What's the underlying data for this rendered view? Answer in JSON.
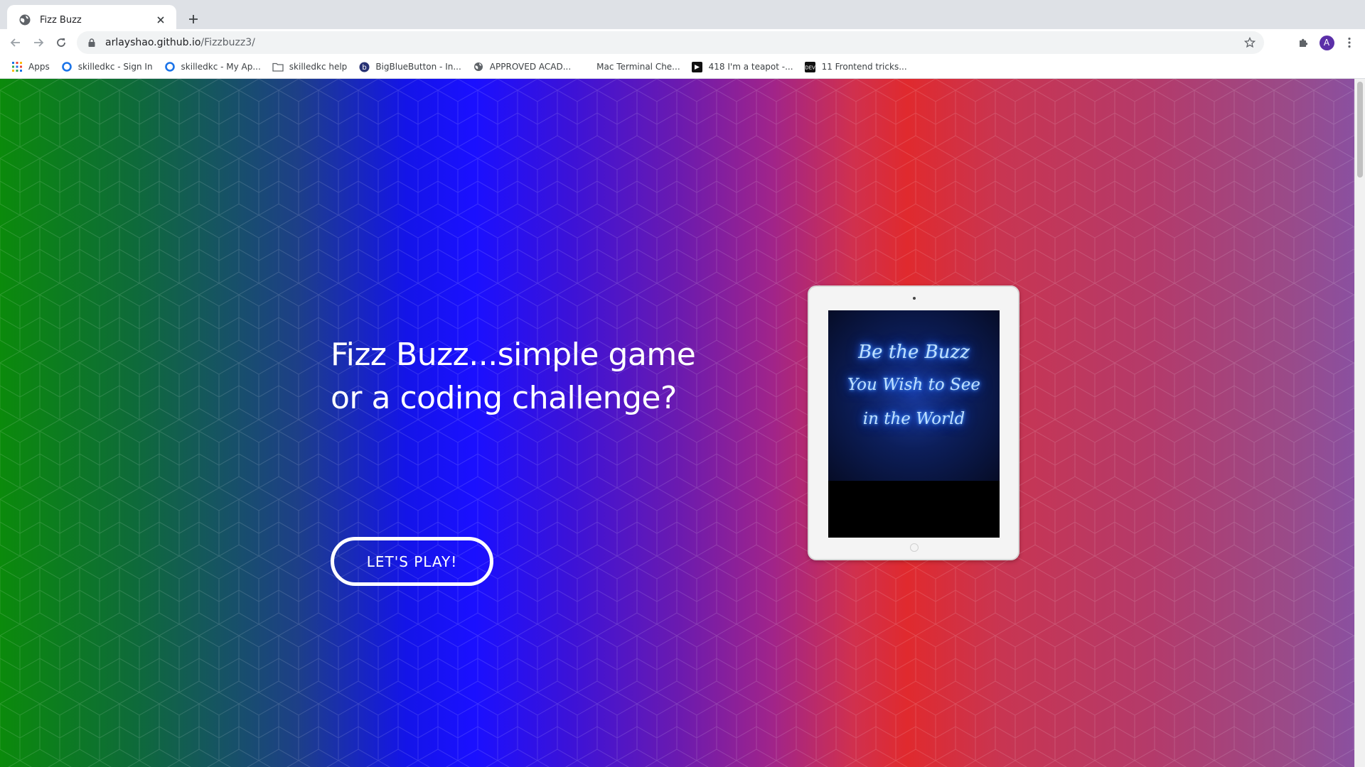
{
  "browser": {
    "tab": {
      "title": "Fizz Buzz",
      "favicon": "globe-icon",
      "close": "close-icon"
    },
    "new_tab": "plus-icon",
    "url_host": "arlayshao.github.io",
    "url_path": "/Fizzbuzz3/",
    "profile_initial": "A",
    "bookmarks": [
      {
        "label": "Apps",
        "icon": "apps-grid-icon"
      },
      {
        "label": "skilledkc - Sign In",
        "icon": "circle-logo-icon"
      },
      {
        "label": "skilledkc - My Ap...",
        "icon": "circle-logo-icon"
      },
      {
        "label": "skilledkc help",
        "icon": "folder-icon"
      },
      {
        "label": "BigBlueButton - In...",
        "icon": "bigbluebutton-icon"
      },
      {
        "label": "APPROVED ACAD...",
        "icon": "globe-icon"
      },
      {
        "label": "Mac Terminal Che...",
        "icon": "blank-icon"
      },
      {
        "label": "418 I'm a teapot -...",
        "icon": "teapot-icon"
      },
      {
        "label": "11 Frontend tricks...",
        "icon": "dev-icon"
      }
    ]
  },
  "page": {
    "headline_line1": "Fizz Buzz...simple game",
    "headline_line2": "or a coding challenge?",
    "cta_label": "LET'S PLAY!",
    "tablet_sign": {
      "line1": "Be the Buzz",
      "line2": "You Wish to See",
      "line3": "in the World"
    }
  },
  "colors": {
    "accent_purple": "#5b2fa8",
    "neon_blue": "#2a6cff"
  }
}
